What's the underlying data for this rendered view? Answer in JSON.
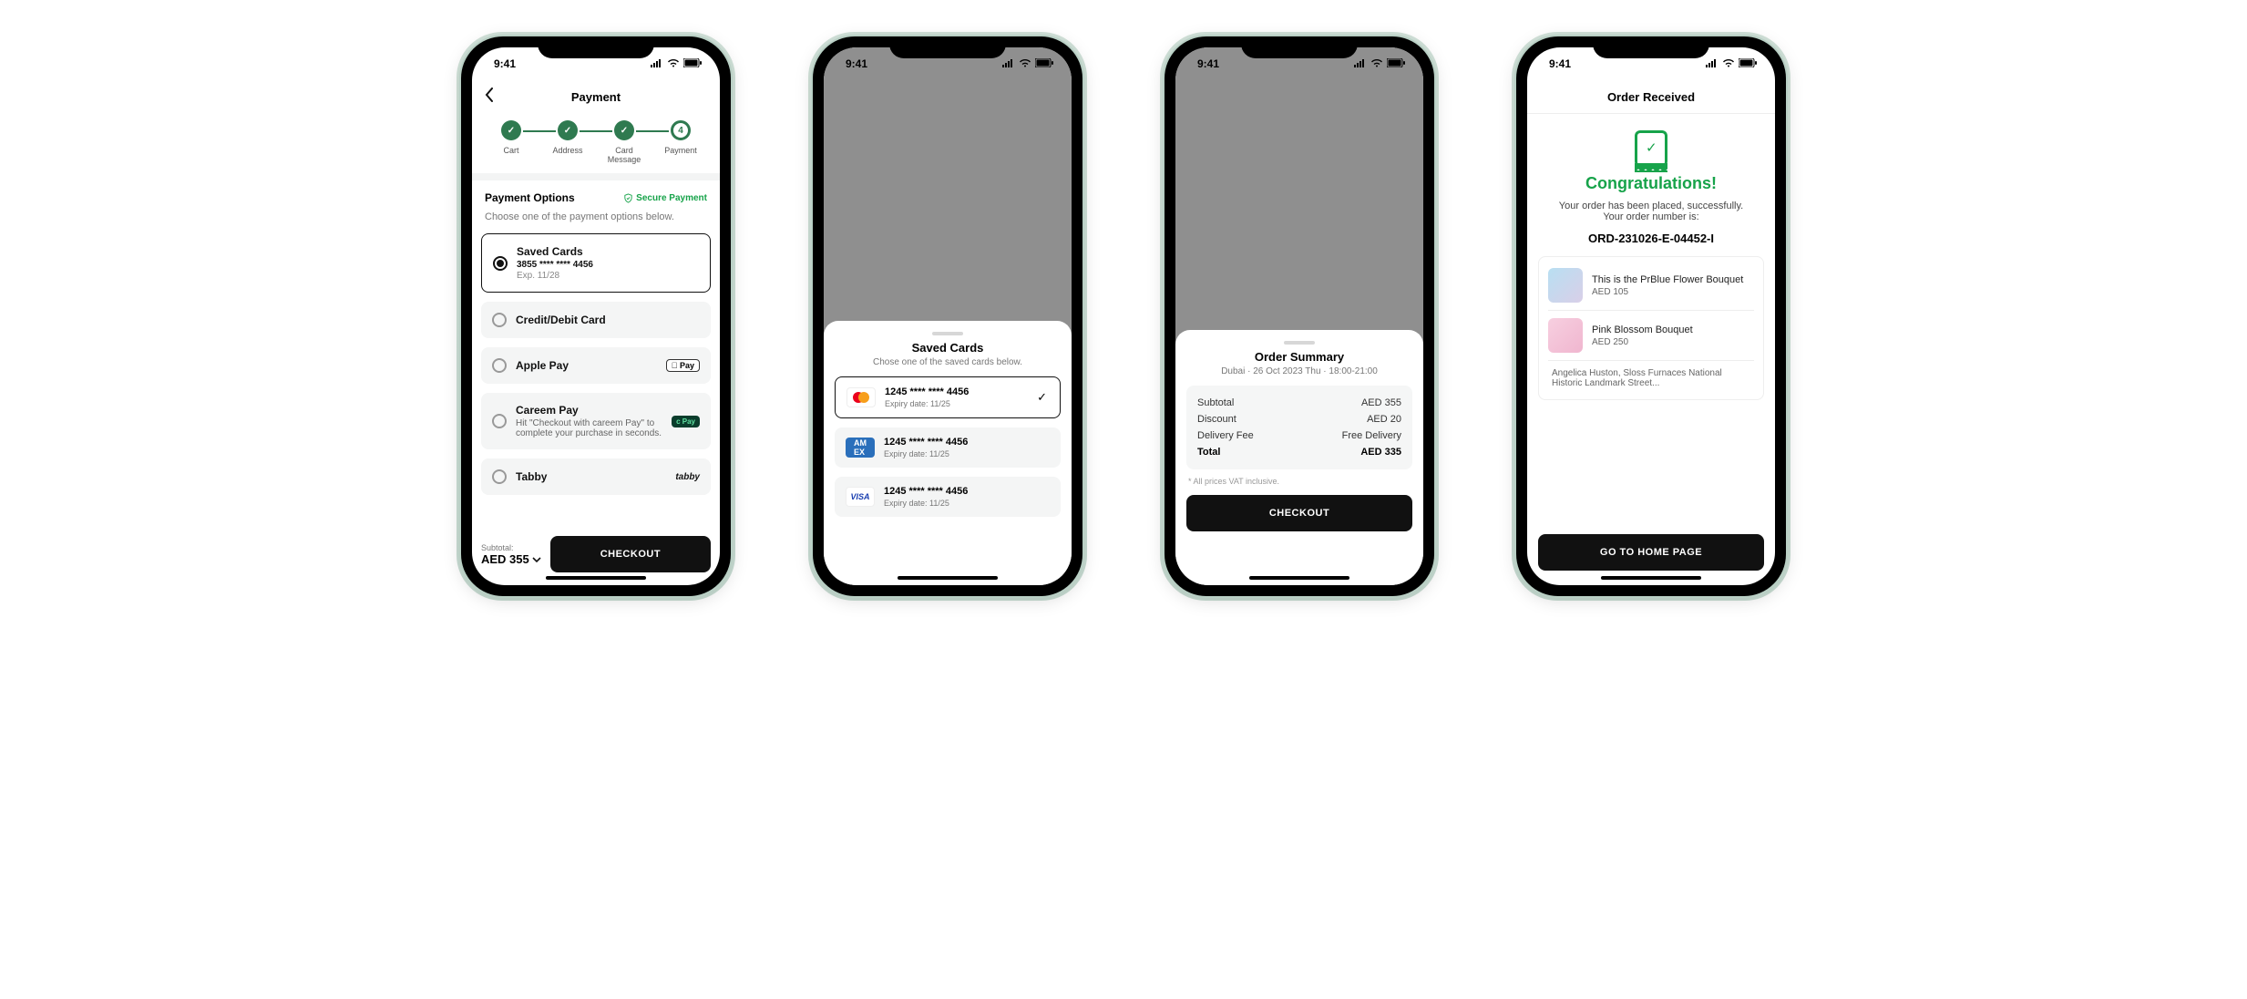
{
  "status": {
    "time": "9:41"
  },
  "screen1": {
    "title": "Payment",
    "steps": [
      "Cart",
      "Address",
      "Card Message",
      "Payment"
    ],
    "current_step_number": "4",
    "options_title": "Payment Options",
    "secure_label": "Secure Payment",
    "choose_hint": "Choose one of the payment options below.",
    "saved": {
      "title": "Saved Cards",
      "mask": "3855  ****  ****  4456",
      "exp": "Exp. 11/28"
    },
    "credit_label": "Credit/Debit Card",
    "apple_label": "Apple Pay",
    "apple_badge": " Pay",
    "careem": {
      "title": "Careem Pay",
      "sub": "Hit \"Checkout with careem Pay\" to complete your purchase in seconds.",
      "badge": "c Pay"
    },
    "tabby_label": "Tabby",
    "tabby_badge": "tabby",
    "subtotal_label": "Subtotal:",
    "subtotal_value": "AED 355",
    "checkout": "CHECKOUT"
  },
  "screen2": {
    "title": "Saved Cards",
    "sub": "Chose one of the saved cards below.",
    "cards": [
      {
        "brand": "mastercard",
        "mask": "1245  ****  ****  4456",
        "exp": "Expiry date: 11/25"
      },
      {
        "brand": "amex",
        "mask": "1245  ****  ****  4456",
        "exp": "Expiry date: 11/25"
      },
      {
        "brand": "visa",
        "mask": "1245  ****  ****  4456",
        "exp": "Expiry date: 11/25"
      }
    ]
  },
  "screen3": {
    "title": "Order Summary",
    "meta": "Dubai · 26 Oct 2023 Thu · 18:00-21:00",
    "rows": {
      "subtotal_l": "Subtotal",
      "subtotal_v": "AED 355",
      "discount_l": "Discount",
      "discount_v": "AED 20",
      "delivery_l": "Delivery Fee",
      "delivery_v": "Free Delivery",
      "total_l": "Total",
      "total_v": "AED 335"
    },
    "vat": "* All prices VAT inclusive.",
    "checkout": "CHECKOUT"
  },
  "screen4": {
    "title": "Order Received",
    "congrats": "Congratulations!",
    "placed": "Your order has been placed, successfully. Your order number is:",
    "order_no": "ORD-231026-E-04452-I",
    "items": [
      {
        "name": "This is the PrBlue Flower Bouquet",
        "price": "AED 105"
      },
      {
        "name": "Pink Blossom Bouquet",
        "price": "AED 250"
      }
    ],
    "address": "Angelica Huston, Sloss Furnaces National Historic Landmark Street...",
    "home_btn": "GO TO HOME PAGE"
  }
}
